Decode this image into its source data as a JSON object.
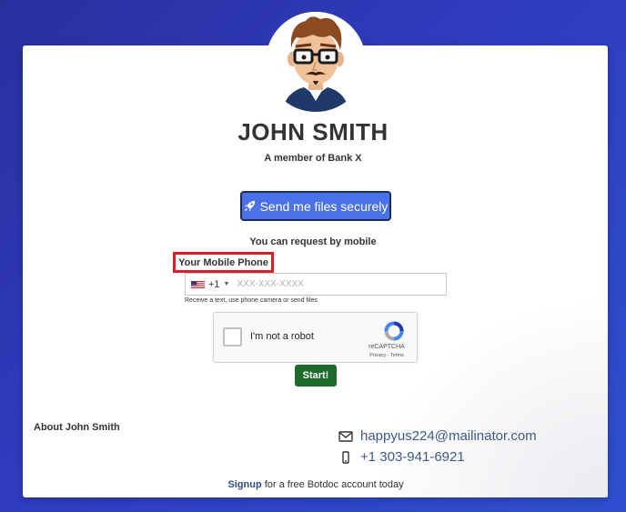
{
  "profile": {
    "name": "JOHN SMITH",
    "subtitle": "A member of Bank X"
  },
  "send_button": {
    "label": "Send me files securely",
    "icon": "rocket-icon",
    "bg_color": "#4a72e8"
  },
  "request": {
    "text": "You can request by mobile",
    "phone_label": "Your Mobile Phone",
    "country_code": "+1",
    "country_flag": "us-flag-icon",
    "phone_placeholder": "XXX-XXX-XXXX",
    "hint": "Receive a text, use phone camera or send files"
  },
  "recaptcha": {
    "label": "I'm not a robot",
    "brand": "reCAPTCHA",
    "privacy": "Privacy",
    "separator": " - ",
    "terms": "Terms"
  },
  "start_button": {
    "label": "Start!",
    "bg_color": "#1e6a2b"
  },
  "about": {
    "label": "About John Smith"
  },
  "contact": {
    "email": "happyus224@mailinator.com",
    "email_icon": "envelope-icon",
    "phone": "+1 303-941-6921",
    "phone_icon": "mobile-phone-icon",
    "link_color": "#3a5a8a"
  },
  "footer": {
    "signup_link": "Signup",
    "text": " for a free Botdoc account today"
  },
  "highlight_color": "#d61f26"
}
